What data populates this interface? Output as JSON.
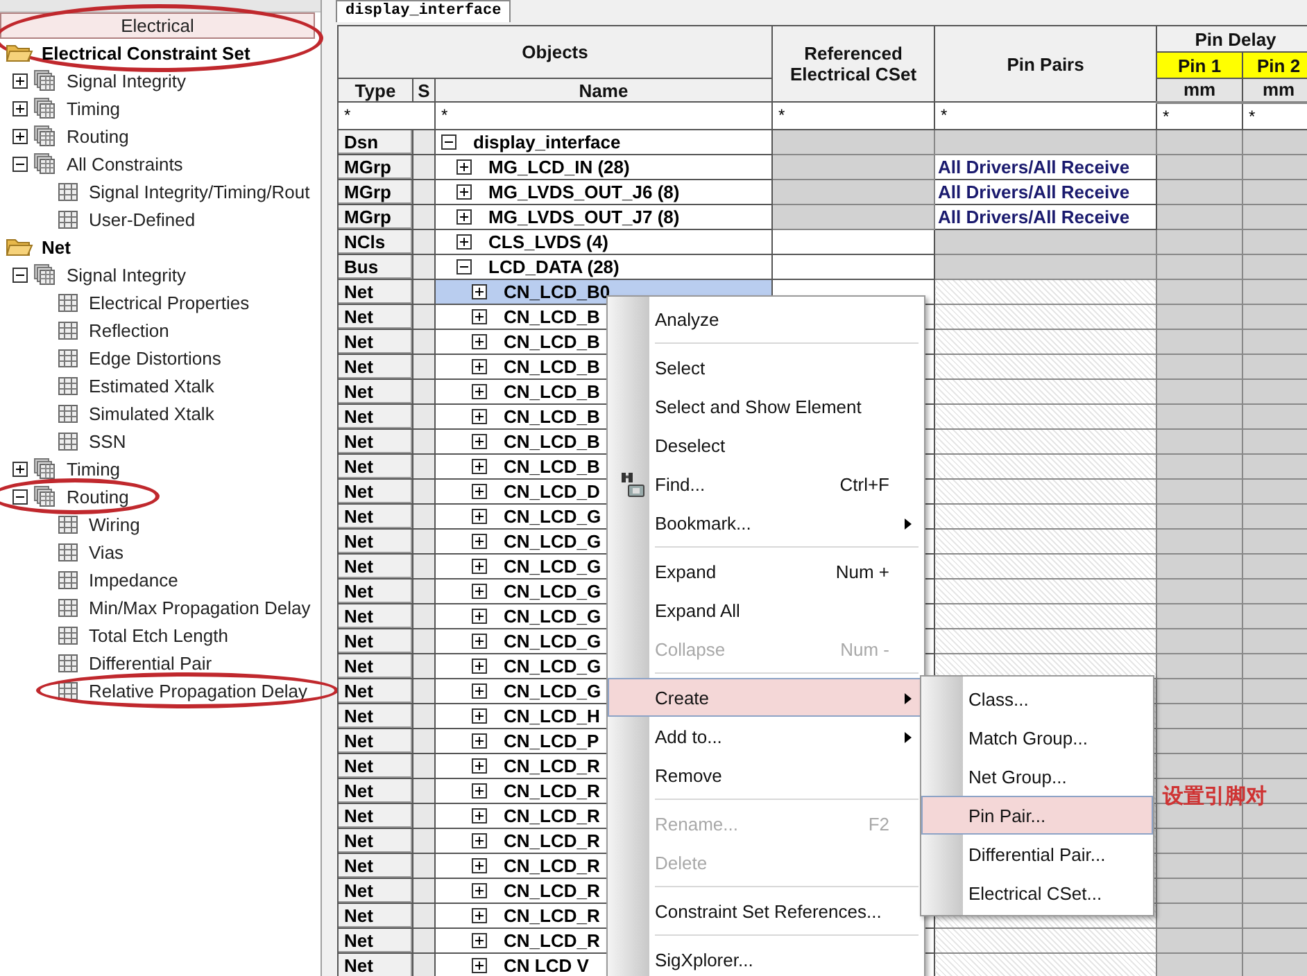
{
  "panel_tab": {
    "label": "Electrical",
    "selected": true,
    "circled": true
  },
  "tree": [
    {
      "label": "Electrical Constraint Set",
      "expanded": true,
      "circled": false,
      "children": [
        {
          "label": "Signal Integrity",
          "expanded": false,
          "circled": false
        },
        {
          "label": "Timing",
          "expanded": false,
          "circled": false
        },
        {
          "label": "Routing",
          "expanded": false,
          "circled": false
        },
        {
          "label": "All Constraints",
          "expanded": true,
          "circled": false,
          "children": [
            {
              "label": "Signal Integrity/Timing/Rout",
              "circled": false
            },
            {
              "label": "User-Defined",
              "circled": false
            }
          ]
        }
      ]
    },
    {
      "label": "Net",
      "expanded": true,
      "circled": false,
      "children": [
        {
          "label": "Signal Integrity",
          "expanded": true,
          "circled": false,
          "children": [
            {
              "label": "Electrical Properties",
              "circled": false
            },
            {
              "label": "Reflection",
              "circled": false
            },
            {
              "label": "Edge Distortions",
              "circled": false
            },
            {
              "label": "Estimated Xtalk",
              "circled": false
            },
            {
              "label": "Simulated Xtalk",
              "circled": false
            },
            {
              "label": "SSN",
              "circled": false
            }
          ]
        },
        {
          "label": "Timing",
          "expanded": false,
          "circled": false
        },
        {
          "label": "Routing",
          "expanded": true,
          "circled": true,
          "children": [
            {
              "label": "Wiring",
              "circled": false
            },
            {
              "label": "Vias",
              "circled": false
            },
            {
              "label": "Impedance",
              "circled": false
            },
            {
              "label": "Min/Max Propagation Delay",
              "circled": false
            },
            {
              "label": "Total Etch Length",
              "circled": false
            },
            {
              "label": "Differential Pair",
              "circled": false
            },
            {
              "label": "Relative Propagation Delay",
              "circled": true
            }
          ]
        }
      ]
    }
  ],
  "document_tab": {
    "label": "display_interface"
  },
  "table": {
    "header": {
      "group": "Objects",
      "type": "Type",
      "s": "S",
      "name": "Name",
      "referenced": "Referenced Electrical CSet",
      "pin_pairs": "Pin Pairs",
      "pin_delay": "Pin Delay",
      "pin_columns": [
        {
          "label": "Pin 1",
          "unit": "mm"
        },
        {
          "label": "Pin 2",
          "unit": "mm"
        }
      ]
    },
    "filters": [
      "*",
      "*",
      "*",
      "*",
      "*",
      "*"
    ],
    "rows": [
      {
        "type": "Dsn",
        "kind": "design",
        "name": "display_interface",
        "expanded": true,
        "selected": false,
        "children": [
          {
            "type": "MGrp",
            "kind": "match_group",
            "name": "MG_LCD_IN (28)",
            "expanded": false,
            "selected": false,
            "pin_pairs": "All Drivers/All Receive"
          },
          {
            "type": "MGrp",
            "kind": "match_group",
            "name": "MG_LVDS_OUT_J6 (8)",
            "expanded": false,
            "selected": false,
            "pin_pairs": "All Drivers/All Receive"
          },
          {
            "type": "MGrp",
            "kind": "match_group",
            "name": "MG_LVDS_OUT_J7 (8)",
            "expanded": false,
            "selected": false,
            "pin_pairs": "All Drivers/All Receive"
          },
          {
            "type": "NCls",
            "kind": "net_class",
            "name": "CLS_LVDS (4)",
            "expanded": false,
            "selected": false
          },
          {
            "type": "Bus",
            "kind": "bus",
            "name": "LCD_DATA (28)",
            "expanded": true,
            "selected": false,
            "children": [
              {
                "type": "Net",
                "kind": "net",
                "name": "CN_LCD_B0",
                "expanded": false,
                "selected": true
              },
              {
                "type": "Net",
                "kind": "net",
                "name": "CN_LCD_B",
                "expanded": false,
                "selected": false
              },
              {
                "type": "Net",
                "kind": "net",
                "name": "CN_LCD_B",
                "expanded": false,
                "selected": false
              },
              {
                "type": "Net",
                "kind": "net",
                "name": "CN_LCD_B",
                "expanded": false,
                "selected": false
              },
              {
                "type": "Net",
                "kind": "net",
                "name": "CN_LCD_B",
                "expanded": false,
                "selected": false
              },
              {
                "type": "Net",
                "kind": "net",
                "name": "CN_LCD_B",
                "expanded": false,
                "selected": false
              },
              {
                "type": "Net",
                "kind": "net",
                "name": "CN_LCD_B",
                "expanded": false,
                "selected": false
              },
              {
                "type": "Net",
                "kind": "net",
                "name": "CN_LCD_B",
                "expanded": false,
                "selected": false
              },
              {
                "type": "Net",
                "kind": "net",
                "name": "CN_LCD_D",
                "expanded": false,
                "selected": false
              },
              {
                "type": "Net",
                "kind": "net",
                "name": "CN_LCD_G",
                "expanded": false,
                "selected": false
              },
              {
                "type": "Net",
                "kind": "net",
                "name": "CN_LCD_G",
                "expanded": false,
                "selected": false
              },
              {
                "type": "Net",
                "kind": "net",
                "name": "CN_LCD_G",
                "expanded": false,
                "selected": false
              },
              {
                "type": "Net",
                "kind": "net",
                "name": "CN_LCD_G",
                "expanded": false,
                "selected": false
              },
              {
                "type": "Net",
                "kind": "net",
                "name": "CN_LCD_G",
                "expanded": false,
                "selected": false
              },
              {
                "type": "Net",
                "kind": "net",
                "name": "CN_LCD_G",
                "expanded": false,
                "selected": false
              },
              {
                "type": "Net",
                "kind": "net",
                "name": "CN_LCD_G",
                "expanded": false,
                "selected": false
              },
              {
                "type": "Net",
                "kind": "net",
                "name": "CN_LCD_G",
                "expanded": false,
                "selected": false
              },
              {
                "type": "Net",
                "kind": "net",
                "name": "CN_LCD_H",
                "expanded": false,
                "selected": false
              },
              {
                "type": "Net",
                "kind": "net",
                "name": "CN_LCD_P",
                "expanded": false,
                "selected": false
              },
              {
                "type": "Net",
                "kind": "net",
                "name": "CN_LCD_R",
                "expanded": false,
                "selected": false
              },
              {
                "type": "Net",
                "kind": "net",
                "name": "CN_LCD_R",
                "expanded": false,
                "selected": false
              },
              {
                "type": "Net",
                "kind": "net",
                "name": "CN_LCD_R",
                "expanded": false,
                "selected": false
              },
              {
                "type": "Net",
                "kind": "net",
                "name": "CN_LCD_R",
                "expanded": false,
                "selected": false
              },
              {
                "type": "Net",
                "kind": "net",
                "name": "CN_LCD_R",
                "expanded": false,
                "selected": false
              },
              {
                "type": "Net",
                "kind": "net",
                "name": "CN_LCD_R",
                "expanded": false,
                "selected": false
              },
              {
                "type": "Net",
                "kind": "net",
                "name": "CN_LCD_R",
                "expanded": false,
                "selected": false
              },
              {
                "type": "Net",
                "kind": "net",
                "name": "CN_LCD_R",
                "expanded": false,
                "selected": false
              },
              {
                "type": "Net",
                "kind": "net",
                "name": "CN LCD V",
                "expanded": false,
                "selected": false
              }
            ]
          }
        ]
      }
    ]
  },
  "context_menu": {
    "groups": [
      [
        {
          "label": "Analyze",
          "kind": "plain",
          "disabled": false,
          "selected": false,
          "submenu": false
        }
      ],
      [
        {
          "label": "Select",
          "kind": "plain",
          "disabled": false,
          "selected": false,
          "submenu": false
        },
        {
          "label": "Select and Show Element",
          "kind": "plain",
          "disabled": false,
          "selected": false,
          "submenu": false
        },
        {
          "label": "Deselect",
          "kind": "plain",
          "disabled": false,
          "selected": false,
          "submenu": false
        },
        {
          "label": "Find...",
          "shortcut": "Ctrl+F",
          "kind": "with_icon",
          "disabled": false,
          "selected": false,
          "submenu": false
        },
        {
          "label": "Bookmark...",
          "disabled": false,
          "selected": false,
          "submenu": true
        }
      ],
      [
        {
          "label": "Expand",
          "shortcut": "Num +",
          "disabled": false,
          "selected": false,
          "submenu": false
        },
        {
          "label": "Expand All",
          "disabled": false,
          "selected": false,
          "submenu": false
        },
        {
          "label": "Collapse",
          "shortcut": "Num -",
          "disabled": true,
          "selected": false,
          "submenu": false
        }
      ],
      [
        {
          "label": "Create",
          "disabled": false,
          "selected": true,
          "submenu": true
        },
        {
          "label": "Add to...",
          "disabled": false,
          "selected": false,
          "submenu": true
        },
        {
          "label": "Remove",
          "disabled": false,
          "selected": false,
          "submenu": false
        }
      ],
      [
        {
          "label": "Rename...",
          "shortcut": "F2",
          "disabled": true,
          "selected": false,
          "submenu": false
        },
        {
          "label": "Delete",
          "disabled": true,
          "selected": false,
          "submenu": false
        }
      ],
      [
        {
          "label": "Constraint Set References...",
          "disabled": false,
          "selected": false,
          "submenu": false
        }
      ],
      [
        {
          "label": "SigXplorer...",
          "disabled": false,
          "selected": false,
          "submenu": false
        }
      ]
    ]
  },
  "submenu": {
    "items": [
      {
        "label": "Class...",
        "selected": false
      },
      {
        "label": "Match Group...",
        "selected": false
      },
      {
        "label": "Net Group...",
        "selected": false
      },
      {
        "label": "Pin Pair...",
        "selected": true
      },
      {
        "label": "Differential Pair...",
        "selected": false
      },
      {
        "label": "Electrical CSet...",
        "selected": false
      }
    ]
  },
  "annotation_text": "设置引脚对"
}
